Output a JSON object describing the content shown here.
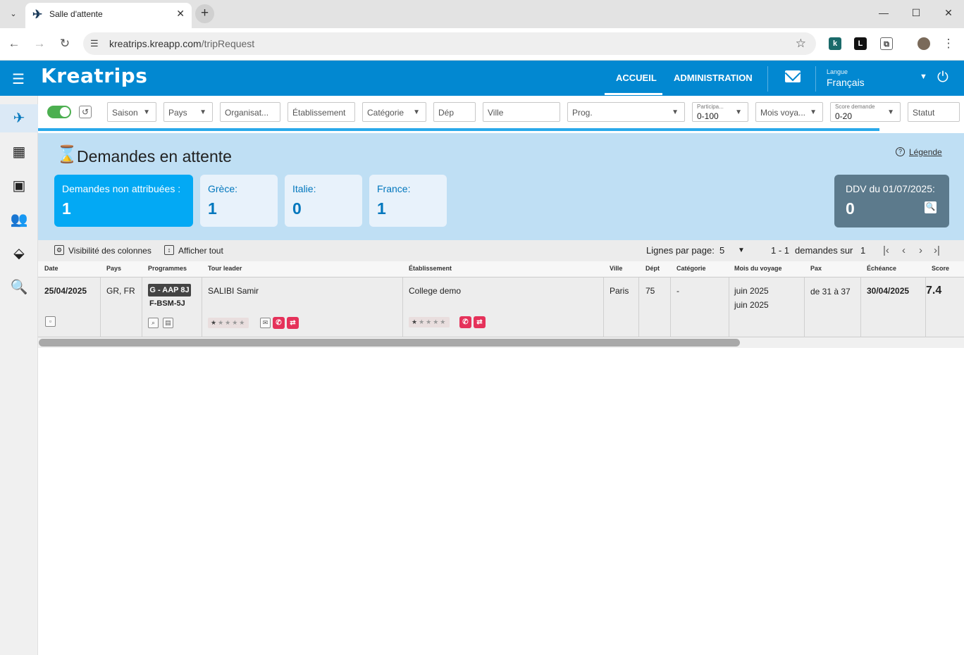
{
  "browser": {
    "tab_title": "Salle d'attente",
    "url_host": "kreatrips.kreapp.com",
    "url_path": "/tripRequest"
  },
  "header": {
    "logo": "Kreatrips",
    "nav": [
      "ACCUEIL",
      "ADMINISTRATION"
    ],
    "active_nav": "ACCUEIL",
    "lang_label": "Langue",
    "lang_value": "Français"
  },
  "sidebar": {
    "items": [
      "plane-icon",
      "dashboard-icon",
      "calendar-icon",
      "users-icon",
      "handshake-icon",
      "travel-search-icon"
    ],
    "active": "plane-icon"
  },
  "filters": {
    "saison": "Saison",
    "pays": "Pays",
    "organisation": "Organisat...",
    "etablissement": "Établissement",
    "categorie": "Catégorie",
    "dep": "Dép",
    "ville": "Ville",
    "prog": "Prog.",
    "participants_label": "Participa...",
    "participants_value": "0-100",
    "mois": "Mois voya...",
    "score_label": "Score demande",
    "score_value": "0-20",
    "statut": "Statut"
  },
  "summary": {
    "title": "Demandes en attente",
    "legend_link": "Légende",
    "cards": [
      {
        "label": "Demandes non attribuées :",
        "value": "1"
      },
      {
        "label": "Grèce:",
        "value": "1"
      },
      {
        "label": "Italie:",
        "value": "0"
      },
      {
        "label": "France:",
        "value": "1"
      }
    ],
    "ddv": {
      "label": "DDV du 01/07/2025:",
      "value": "0"
    }
  },
  "table_tools": {
    "columns_visibility": "Visibilité des colonnes",
    "show_all": "Afficher tout",
    "rows_per_page_label": "Lignes par page:",
    "rows_per_page": "5",
    "range": "1 - 1",
    "of_label": "demandes sur",
    "total": "1"
  },
  "table": {
    "headers": [
      "Date",
      "Pays",
      "Programmes",
      "Tour leader",
      "Établissement",
      "Ville",
      "Dépt",
      "Catégorie",
      "Mois du voyage",
      "Pax",
      "Échéance",
      "Score"
    ],
    "row": {
      "date": "25/04/2025",
      "pays": "GR, FR",
      "prog_badge": "G - AAP 8J",
      "prog_code": "F-BSM-5J",
      "tour_leader": "SALIBI Samir",
      "etablissement": "College demo",
      "ville": "Paris",
      "dept": "75",
      "categorie": "-",
      "mois1": "juin 2025",
      "mois2": "juin 2025",
      "pax": "de 31 à 37",
      "echeance": "30/04/2025",
      "score": "7.4"
    }
  },
  "colors": {
    "brand": "#0288d1",
    "summary_bg": "#bfdff4",
    "primary_card": "#03a9f4",
    "ddv_card": "#5c7a8c",
    "alert": "#e5325a"
  }
}
